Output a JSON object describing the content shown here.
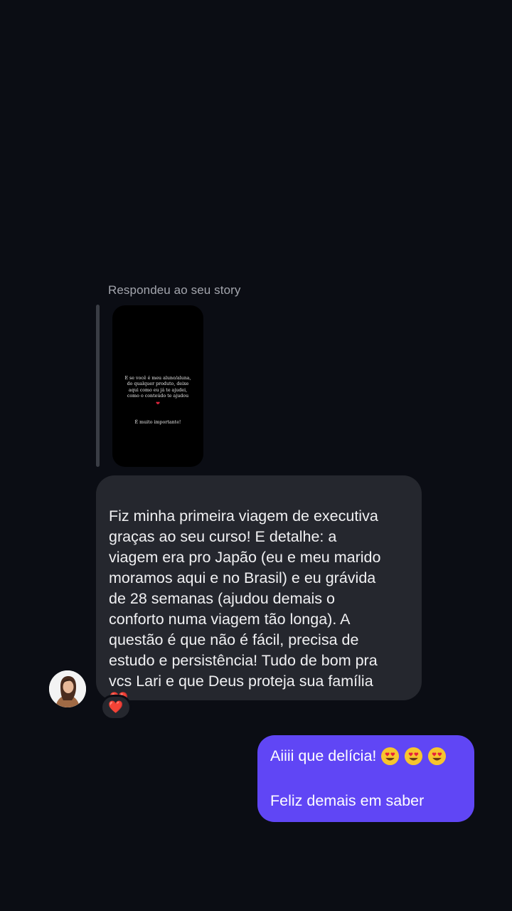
{
  "reply": {
    "label": "Respondeu ao seu story"
  },
  "story": {
    "text": "E se você é meu aluno/aluna,\ndo qualquer produto, deixe\naqui como eu já te ajudei,\ncomo o conteúdo te ajudou",
    "heart": "❤",
    "text2": "É muito importante!"
  },
  "incoming": {
    "message": "Fiz minha primeira viagem de executiva\ngraças ao seu curso! E detalhe: a\nviagem era pro Japão (eu e meu marido\nmoramos aqui e no Brasil) e eu grávida\nde 28 semanas (ajudou demais o\nconforto numa viagem tão longa). A\nquestão é que não é fácil, precisa de\nestudo e persistência! Tudo de bom pra\nvcs Lari e que Deus proteja sua família",
    "heart": "❤️",
    "reaction": "❤️"
  },
  "outgoing": {
    "line1": "Aiiii que delícia!",
    "line2": "Feliz demais em saber",
    "emoji_icon": "heart-eyes-emoji",
    "bubble_color": "#6046f5"
  },
  "colors": {
    "background": "#0b0d14",
    "incoming_bubble": "#25272e",
    "heart": "#ef2c3c"
  }
}
